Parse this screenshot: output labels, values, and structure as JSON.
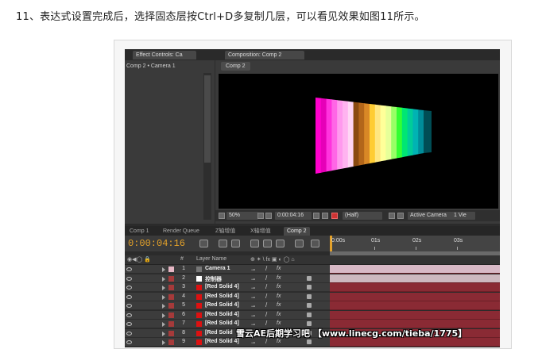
{
  "caption": "11、表达式设置完成后，选择固态层按Ctrl+D多复制几层，可以看见效果如图11所示。",
  "effect_controls": {
    "tab": "Effect Controls: Ca",
    "subtitle": "Comp 2 • Camera 1"
  },
  "composition": {
    "tab": "Composition: Comp 2",
    "breadcrumb": "Comp 2",
    "bar_colors": [
      "#ff00cc",
      "#e600b8",
      "#ff33dd",
      "#ff66e6",
      "#ff99ee",
      "#ffb3f0",
      "#ffd6f5",
      "#8a4a10",
      "#b3661a",
      "#d98826",
      "#ffcc33",
      "#ffe680",
      "#ffff99",
      "#e6ff99",
      "#99ff66",
      "#33ff33",
      "#00e673",
      "#00cc99",
      "#00b3b3",
      "#008c99"
    ]
  },
  "viewer_controls": {
    "zoom": "50%",
    "timecode": "0:00:04:16",
    "resolution": "(Half)",
    "camera": "Active Camera",
    "views": "1 Vie"
  },
  "timeline_tabs": [
    "Comp 1",
    "Render Queue",
    "Z轴增值",
    "X轴增值",
    "Comp 2"
  ],
  "timeline": {
    "timecode": "0:00:04:16",
    "ruler_labels": [
      "0:00s",
      "01s",
      "02s",
      "03s"
    ],
    "column_headers": {
      "switches": "◉◀◯ 🔒",
      "hash": "#",
      "layer_name": "Layer Name",
      "switch_cols": "⊕ ✶ \\ fx ▣ ◐ ◯ ⌂"
    },
    "layers": [
      {
        "num": "1",
        "name": "Camera 1",
        "label_color": "#e7b7c5",
        "src_color": "#777777"
      },
      {
        "num": "2",
        "name": "控制器",
        "label_color": "#a63a3a",
        "src_color": "#ffffff"
      },
      {
        "num": "3",
        "name": "[Red Solid 4]",
        "label_color": "#a63a3a",
        "src_color": "#dd1111"
      },
      {
        "num": "4",
        "name": "[Red Solid 4]",
        "label_color": "#a63a3a",
        "src_color": "#dd1111"
      },
      {
        "num": "5",
        "name": "[Red Solid 4]",
        "label_color": "#a63a3a",
        "src_color": "#dd1111"
      },
      {
        "num": "6",
        "name": "[Red Solid 4]",
        "label_color": "#a63a3a",
        "src_color": "#dd1111"
      },
      {
        "num": "7",
        "name": "[Red Solid 4]",
        "label_color": "#a63a3a",
        "src_color": "#dd1111"
      },
      {
        "num": "8",
        "name": "[Red Solid",
        "label_color": "#a63a3a",
        "src_color": "#dd1111"
      },
      {
        "num": "9",
        "name": "[Red Solid 4]",
        "label_color": "#a63a3a",
        "src_color": "#dd1111"
      }
    ]
  },
  "watermark": "雪云AE后期学习吧 【www.linecg.com/tieba/1775】",
  "colors": {
    "timecode": "#e3a12a",
    "track_bar": "#8a2a34",
    "panel_bg": "#3a3a3a"
  }
}
